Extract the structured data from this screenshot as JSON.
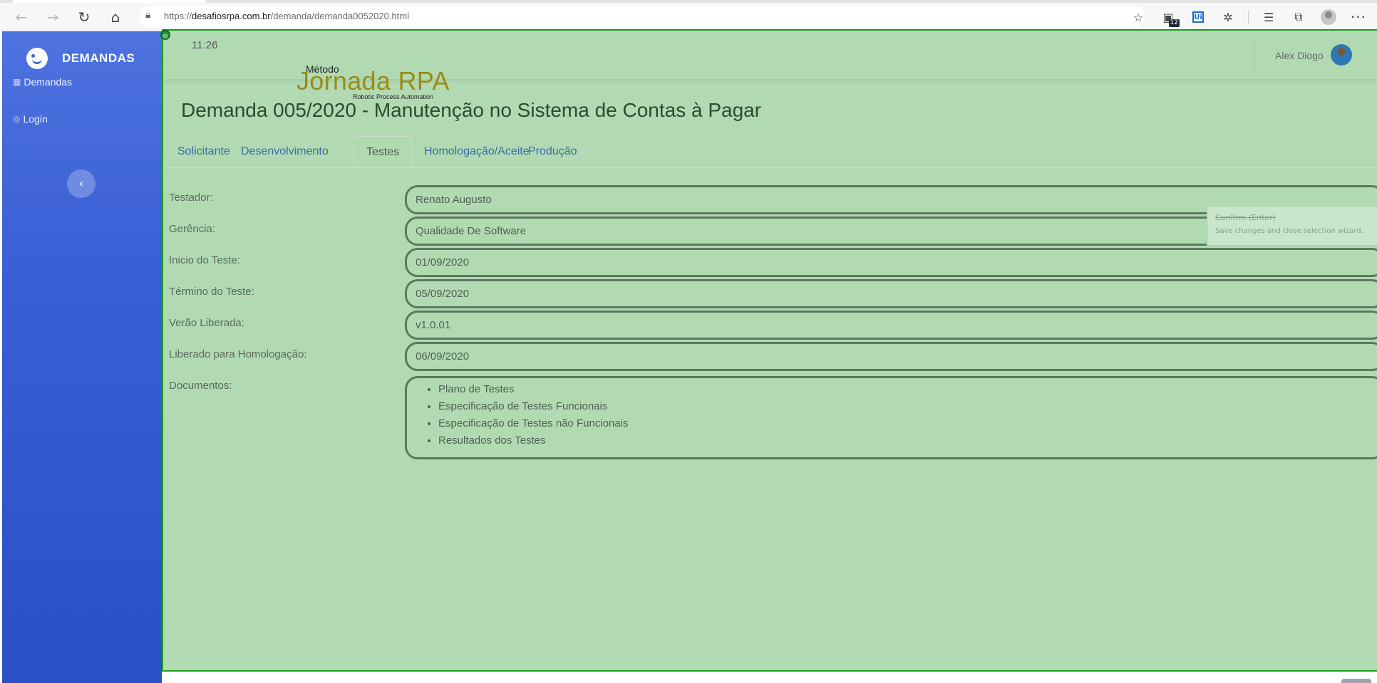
{
  "browser": {
    "url_prefix": "https://",
    "url_host": "desafiosrpa.com.br",
    "url_path": "/demanda/demanda0052020.html",
    "extension_badge": "12",
    "ui_icon_text": "Ui"
  },
  "sidebar": {
    "brand": "DEMANDAS",
    "items": [
      {
        "label": "Demandas"
      },
      {
        "label": "Login"
      }
    ]
  },
  "topbar": {
    "time": "11:26",
    "user_name": "Alex Diogo"
  },
  "logo": {
    "pre": "Método",
    "main": "Jornada RPA",
    "tagline": "Robotic Process Automation"
  },
  "page": {
    "title": "Demanda 005/2020 - Manutenção no Sistema de Contas à Pagar"
  },
  "tabs": [
    {
      "label": "Solicitante"
    },
    {
      "label": "Desenvolvimento"
    },
    {
      "label": "Testes"
    },
    {
      "label": "Homologação/Aceite"
    },
    {
      "label": "Produção"
    }
  ],
  "active_tab": "Testes",
  "form": {
    "testador": {
      "label": "Testador:",
      "value": "Renato Augusto"
    },
    "gerencia": {
      "label": "Gerência:",
      "value": "Qualidade De Software"
    },
    "inicio": {
      "label": "Inicio do Teste:",
      "value": "01/09/2020"
    },
    "termino": {
      "label": "Término do Teste:",
      "value": "05/09/2020"
    },
    "versao": {
      "label": "Verão Liberada:",
      "value": "v1.0.01"
    },
    "liberado": {
      "label": "Liberado para Homologação:",
      "value": "06/09/2020"
    },
    "documentos": {
      "label": "Documentos:",
      "items": [
        "Plano de Testes",
        "Especificação de Testes Funcionais",
        "Especificação de Testes não Funcionais",
        "Resultados dos Testes"
      ]
    }
  },
  "tooltip": {
    "title": "Confirm (Enter)",
    "text": "Save changes and close selection wizard."
  },
  "colors": {
    "sidebar_top": "#4e73df",
    "sidebar_bottom": "#2a50c6",
    "overlay_green": "#b1dab3",
    "overlay_border": "#1a9b1a",
    "field_border": "#5a7a5c",
    "logo_gold": "#9b8c16",
    "tab_link": "#3a6ea5"
  },
  "icons": {
    "back": "arrow-left-icon",
    "forward": "arrow-right-icon",
    "refresh": "refresh-icon",
    "home": "home-icon",
    "lock": "lock-icon",
    "brand": "laugh-wink-icon",
    "demandas": "table-icon",
    "login": "user-circle-icon",
    "collapse": "chevron-left-icon"
  }
}
